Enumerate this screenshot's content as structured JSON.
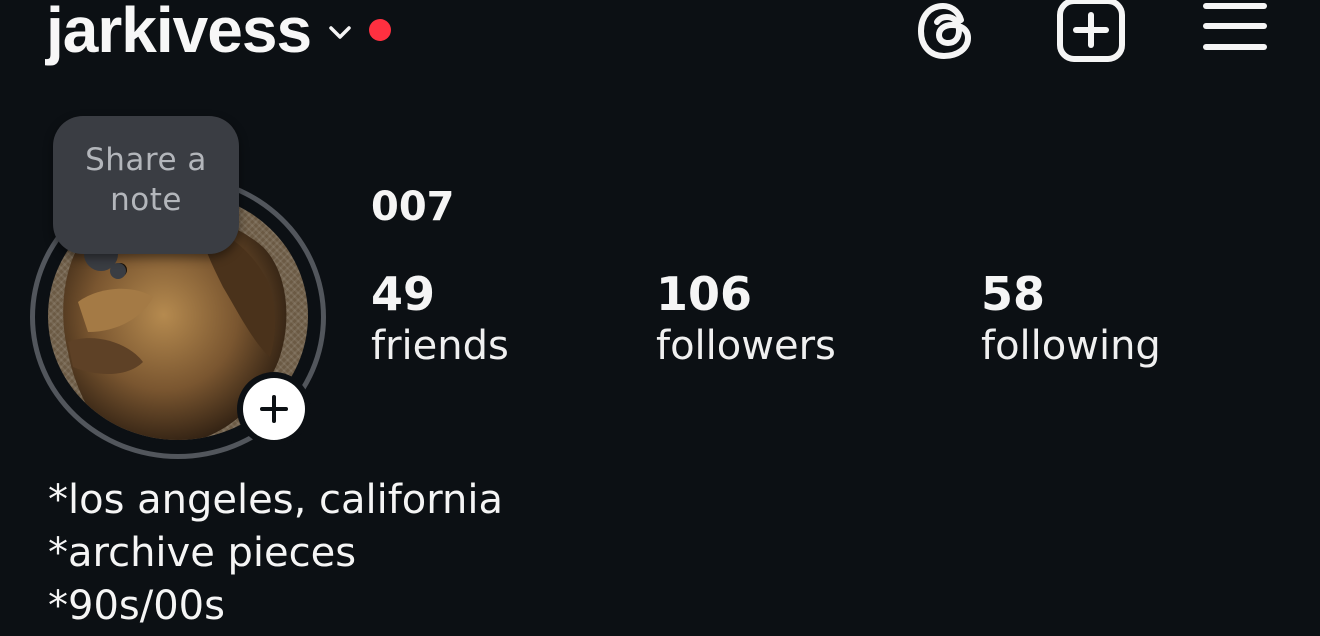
{
  "header": {
    "username": "jarkivess",
    "icons": [
      "chevron-down-icon",
      "notification-dot",
      "threads-icon",
      "add-post-icon",
      "menu-icon"
    ],
    "notification_color": "#ff3040"
  },
  "note": {
    "text": "Share a note"
  },
  "profile": {
    "display_name": "007",
    "stats": [
      {
        "value": "49",
        "label": "friends"
      },
      {
        "value": "106",
        "label": "followers"
      },
      {
        "value": "58",
        "label": "following"
      }
    ],
    "bio": [
      "*los angeles, california",
      "*archive pieces",
      "*90s/00s"
    ]
  },
  "colors": {
    "background": "#0c1014",
    "text": "#f5f5f5",
    "note_bubble": "#3a3d43",
    "ring": "#52565c"
  }
}
